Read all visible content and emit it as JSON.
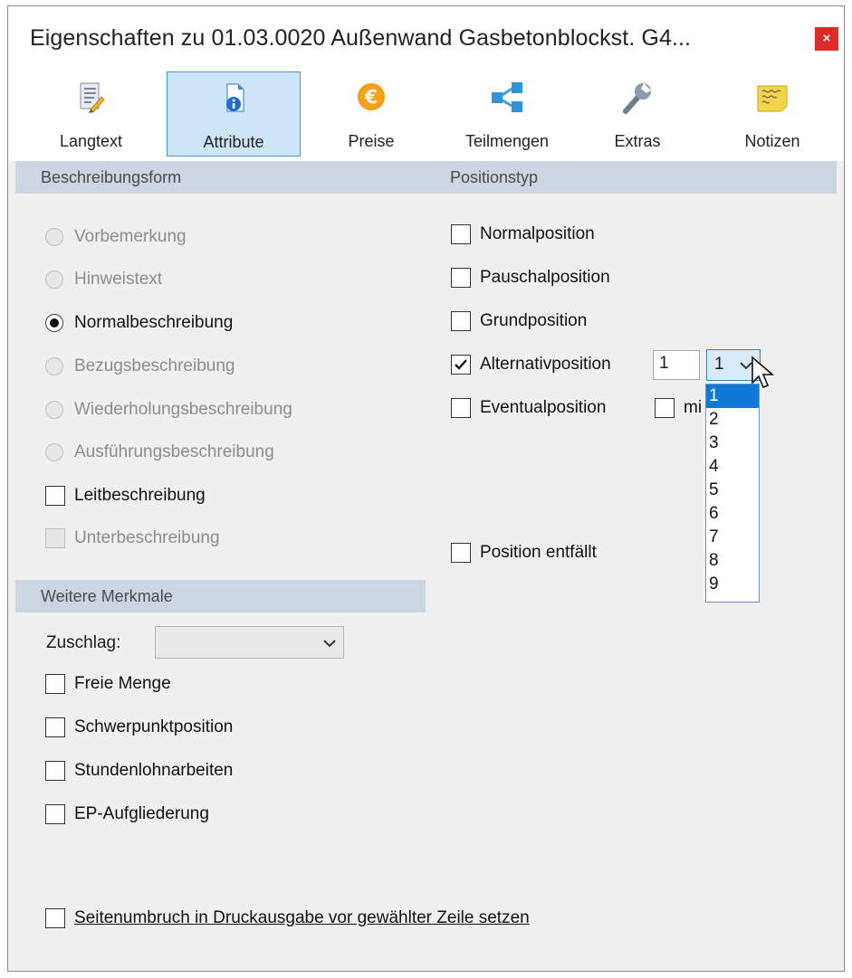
{
  "window": {
    "title": "Eigenschaften zu 01.03.0020 Außenwand Gasbetonblockst. G4...",
    "close": "×"
  },
  "toolbar": {
    "tabs": [
      {
        "label": "Langtext",
        "icon": "document-pencil-icon"
      },
      {
        "label": "Attribute",
        "icon": "info-document-icon",
        "active": true
      },
      {
        "label": "Preise",
        "icon": "euro-icon"
      },
      {
        "label": "Teilmengen",
        "icon": "share-hierarchy-icon"
      },
      {
        "label": "Extras",
        "icon": "wrench-icon"
      },
      {
        "label": "Notizen",
        "icon": "sticky-note-icon"
      }
    ]
  },
  "beschreibungsform": {
    "header": "Beschreibungsform",
    "options": [
      {
        "label": "Vorbemerkung",
        "disabled": true,
        "selected": false
      },
      {
        "label": "Hinweistext",
        "disabled": true,
        "selected": false
      },
      {
        "label": "Normalbeschreibung",
        "disabled": false,
        "selected": true
      },
      {
        "label": "Bezugsbeschreibung",
        "disabled": true,
        "selected": false
      },
      {
        "label": "Wiederholungsbeschreibung",
        "disabled": true,
        "selected": false
      },
      {
        "label": "Ausführungsbeschreibung",
        "disabled": true,
        "selected": false
      }
    ],
    "leitbeschreibung": {
      "label": "Leitbeschreibung",
      "checked": false
    },
    "unterbeschreibung": {
      "label": "Unterbeschreibung",
      "checked": false,
      "disabled": true
    }
  },
  "positionstyp": {
    "header": "Positionstyp",
    "normal": {
      "label": "Normalposition",
      "checked": false
    },
    "pauschal": {
      "label": "Pauschalposition",
      "checked": false
    },
    "grund": {
      "label": "Grundposition",
      "checked": false
    },
    "alternativ": {
      "label": "Alternativposition",
      "checked": true,
      "number": "1",
      "group": "1"
    },
    "eventual": {
      "label": "Eventualposition",
      "checked": false,
      "extra_label": "mi",
      "extra_checked": false
    },
    "entfaellt": {
      "label": "Position entfällt",
      "checked": false
    },
    "dropdown_options": [
      "1",
      "2",
      "3",
      "4",
      "5",
      "6",
      "7",
      "8",
      "9"
    ],
    "dropdown_selected": "1"
  },
  "weitere": {
    "header": "Weitere Merkmale",
    "zuschlag_label": "Zuschlag:",
    "zuschlag_value": "",
    "checks": [
      {
        "label": "Freie Menge",
        "checked": false
      },
      {
        "label": "Schwerpunktposition",
        "checked": false
      },
      {
        "label": "Stundenlohnarbeiten",
        "checked": false
      },
      {
        "label": "EP-Aufgliederung",
        "checked": false
      }
    ]
  },
  "seitenumbruch": {
    "label": "Seitenumbruch in Druckausgabe vor gewählter Zeile setzen",
    "checked": false
  },
  "colors": {
    "accent": "#0c78d8",
    "active_tab_bg": "#cde6f7",
    "header_bg": "#ccd6e2",
    "close_bg": "#e02a28"
  }
}
